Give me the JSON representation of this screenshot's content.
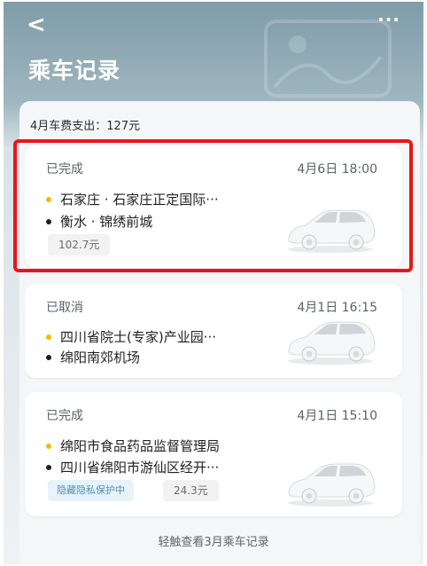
{
  "header": {
    "title": "乘车记录",
    "back_icon": "chevron-left-icon",
    "more_icon": "more-dots-icon",
    "back_symbol": "<",
    "more_symbol": "···"
  },
  "summary": {
    "text": "4月车费支出：127元"
  },
  "trips": [
    {
      "status": "已完成",
      "time": "4月6日 18:00",
      "start": "石家庄 · 石家庄正定国际···",
      "end": "衡水 · 锦绣前城",
      "price": "102.7元",
      "highlighted": true
    },
    {
      "status": "已取消",
      "time": "4月1日 16:15",
      "start": "四川省院士(专家)产业园···",
      "end": "绵阳南郊机场"
    },
    {
      "status": "已完成",
      "time": "4月1日 15:10",
      "start": "绵阳市食品药品监督管理局",
      "end": "四川省绵阳市游仙区经开···",
      "privacy_tag": "隐藏隐私保护中",
      "price": "24.3元"
    }
  ],
  "footer": {
    "link": "轻触查看3月乘车记录"
  },
  "colors": {
    "highlight_border": "#e7161b",
    "start_dot": "#f5b800",
    "header_bg": "#8aa5b0"
  }
}
